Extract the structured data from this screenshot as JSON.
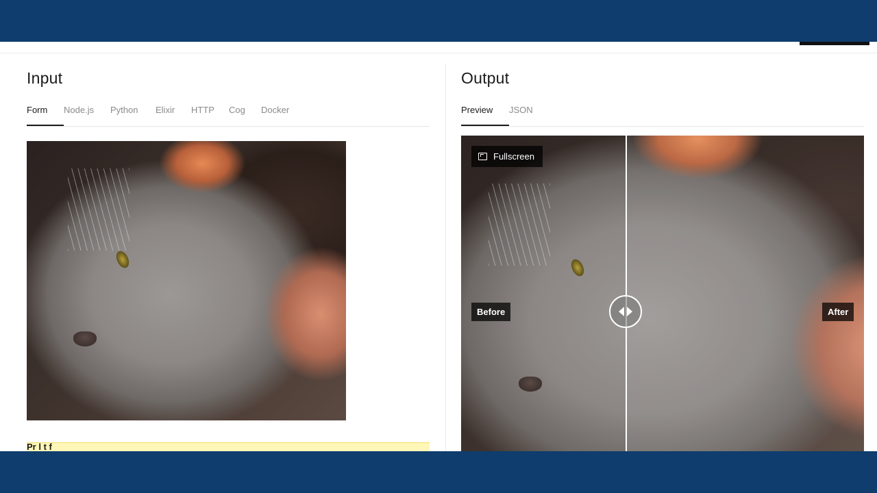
{
  "input": {
    "title": "Input",
    "tabs": [
      {
        "label": "Form",
        "active": true
      },
      {
        "label": "Node.js",
        "active": false
      },
      {
        "label": "Python",
        "active": false
      },
      {
        "label": "Elixir",
        "active": false
      },
      {
        "label": "HTTP",
        "active": false
      },
      {
        "label": "Cog",
        "active": false
      },
      {
        "label": "Docker",
        "active": false
      }
    ],
    "partial_field_label": "Pr  l  t  f"
  },
  "output": {
    "title": "Output",
    "tabs": [
      {
        "label": "Preview",
        "active": true
      },
      {
        "label": "JSON",
        "active": false
      }
    ],
    "fullscreen_label": "Fullscreen",
    "before_label": "Before",
    "after_label": "After",
    "comparison_split": 0.41
  },
  "colors": {
    "header_band": "#0f3d6e",
    "highlight_row": "#fff7b8"
  },
  "icons": [
    "fullscreen-icon",
    "slider-arrows-icon"
  ]
}
